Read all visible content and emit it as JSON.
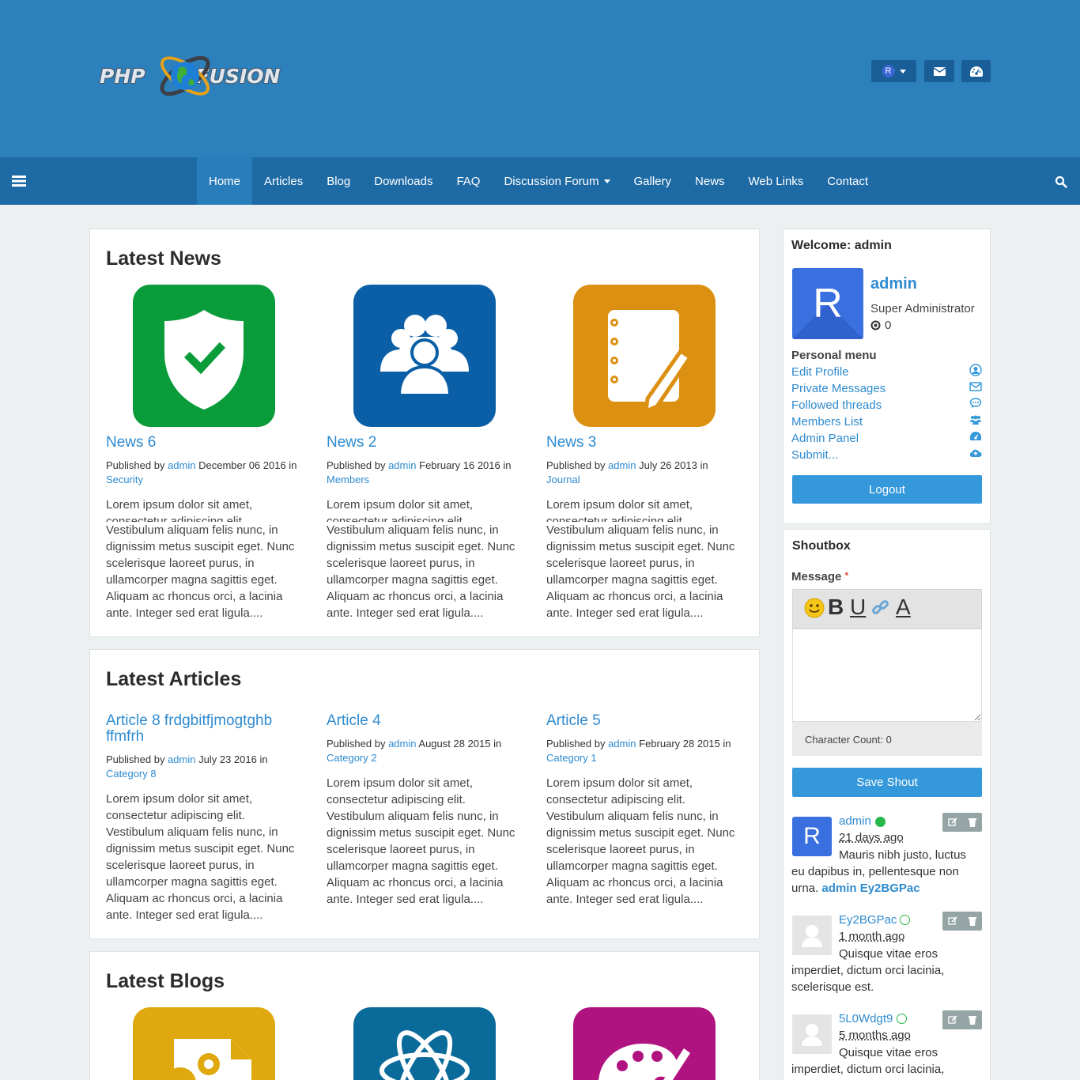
{
  "site": {
    "logo_left": "PHP",
    "logo_right": "FUSION"
  },
  "header": {
    "user_initial": "R"
  },
  "nav": {
    "items": [
      {
        "label": "Home",
        "active": true
      },
      {
        "label": "Articles"
      },
      {
        "label": "Blog"
      },
      {
        "label": "Downloads"
      },
      {
        "label": "FAQ"
      },
      {
        "label": "Discussion Forum"
      },
      {
        "label": "Gallery"
      },
      {
        "label": "News"
      },
      {
        "label": "Web Links"
      },
      {
        "label": "Contact"
      }
    ]
  },
  "news": {
    "heading": "Latest News",
    "items": [
      {
        "title": "News 6",
        "published_by": "Published by",
        "author": "admin",
        "date": "December 06 2016 in",
        "category": "Security",
        "clip1": "Lorem ipsum dolor sit amet,",
        "clip2": "consectetur adipiscing elit.",
        "body": "Vestibulum aliquam felis nunc, in dignissim metus suscipit eget. Nunc scelerisque laoreet purus, in ullamcorper magna sagittis eget. Aliquam ac rhoncus orci, a lacinia ante. Integer sed erat ligula....",
        "color": "#0a9b3a"
      },
      {
        "title": "News 2",
        "published_by": "Published by",
        "author": "admin",
        "date": "February 16 2016 in",
        "category": "Members",
        "clip1": "Lorem ipsum dolor sit amet,",
        "clip2": "consectetur adipiscing elit.",
        "body": "Vestibulum aliquam felis nunc, in dignissim metus suscipit eget. Nunc scelerisque laoreet purus, in ullamcorper magna sagittis eget. Aliquam ac rhoncus orci, a lacinia ante. Integer sed erat ligula....",
        "color": "#0a5fa6"
      },
      {
        "title": "News 3",
        "published_by": "Published by",
        "author": "admin",
        "date": "July 26 2013 in",
        "category": "Journal",
        "clip1": "Lorem ipsum dolor sit amet,",
        "clip2": "consectetur adipiscing elit.",
        "body": "Vestibulum aliquam felis nunc, in dignissim metus suscipit eget. Nunc scelerisque laoreet purus, in ullamcorper magna sagittis eget. Aliquam ac rhoncus orci, a lacinia ante. Integer sed erat ligula....",
        "color": "#dc9012"
      }
    ]
  },
  "articles": {
    "heading": "Latest Articles",
    "items": [
      {
        "title": "Article 8 frdgbitfjmogtghb ffmfrh",
        "published_by": "Published by",
        "author": "admin",
        "date": "July 23 2016 in",
        "category": "Category 8",
        "body": "Lorem ipsum dolor sit amet, consectetur adipiscing elit. Vestibulum aliquam felis nunc, in dignissim metus suscipit eget. Nunc scelerisque laoreet purus, in ullamcorper magna sagittis eget. Aliquam ac rhoncus orci, a lacinia ante. Integer sed erat ligula...."
      },
      {
        "title": "Article 4",
        "published_by": "Published by",
        "author": "admin",
        "date": "August 28 2015 in",
        "category": "Category 2",
        "body": "Lorem ipsum dolor sit amet, consectetur adipiscing elit. Vestibulum aliquam felis nunc, in dignissim metus suscipit eget. Nunc scelerisque laoreet purus, in ullamcorper magna sagittis eget. Aliquam ac rhoncus orci, a lacinia ante. Integer sed erat ligula...."
      },
      {
        "title": "Article 5",
        "published_by": "Published by",
        "author": "admin",
        "date": "February 28 2015 in",
        "category": "Category 1",
        "body": "Lorem ipsum dolor sit amet, consectetur adipiscing elit. Vestibulum aliquam felis nunc, in dignissim metus suscipit eget. Nunc scelerisque laoreet purus, in ullamcorper magna sagittis eget. Aliquam ac rhoncus orci, a lacinia ante. Integer sed erat ligula...."
      }
    ]
  },
  "blogs": {
    "heading": "Latest Blogs",
    "colors": [
      "#e0a80f",
      "#0a6b9b",
      "#b0127f"
    ]
  },
  "welcome": {
    "title": "Welcome: admin",
    "avatar_initial": "R",
    "username": "admin",
    "role": "Super Administrator",
    "points": "0",
    "personal_menu_title": "Personal menu",
    "menu": [
      "Edit Profile",
      "Private Messages",
      "Followed threads",
      "Members List",
      "Admin Panel",
      "Submit..."
    ],
    "logout": "Logout"
  },
  "shoutbox": {
    "title": "Shoutbox",
    "message_label": "Message",
    "required_mark": "*",
    "toolbar": {
      "bold": "B",
      "underline": "U",
      "color": "A"
    },
    "char_count": "Character Count: 0",
    "save": "Save Shout",
    "shouts": [
      {
        "name": "admin",
        "avatar_initial": "R",
        "time": "21 days ago",
        "text": "Mauris nibh justo, luctus eu dapibus in, pellentesque non urna.",
        "mention": "admin Ey2BGPac",
        "online": true
      },
      {
        "name": "Ey2BGPac",
        "time": "1 month ago",
        "text": "Quisque vitae eros imperdiet, dictum orci lacinia, scelerisque est.",
        "online": false
      },
      {
        "name": "5L0Wdgt9",
        "time": "5 months ago",
        "text": "Quisque vitae eros imperdiet, dictum orci lacinia,",
        "online": false
      }
    ]
  }
}
